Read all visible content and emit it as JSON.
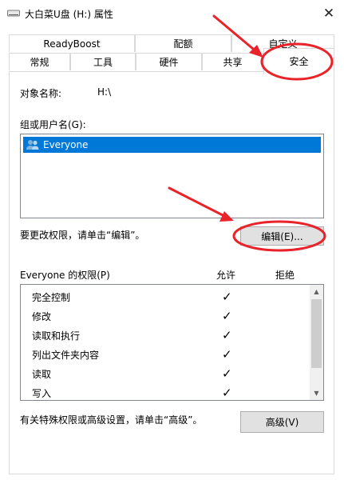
{
  "window": {
    "title": "大白菜U盘 (H:) 属性",
    "close_glyph": "✕"
  },
  "tabs": {
    "back_row": [
      "ReadyBoost",
      "配额",
      "自定义"
    ],
    "front_row": [
      "常规",
      "工具",
      "硬件",
      "共享"
    ],
    "active": "安全"
  },
  "security": {
    "object_name_label": "对象名称:",
    "object_name_value": "H:\\",
    "group_label": "组或用户名(G):",
    "users": [
      "Everyone"
    ],
    "edit_hint": "要更改权限，请单击“编辑”。",
    "edit_button": "编辑(E)...",
    "perm_title": "Everyone 的权限(P)",
    "allow_header": "允许",
    "deny_header": "拒绝",
    "permissions": [
      {
        "name": "完全控制",
        "allow": "✓"
      },
      {
        "name": "修改",
        "allow": "✓"
      },
      {
        "name": "读取和执行",
        "allow": "✓"
      },
      {
        "name": "列出文件夹内容",
        "allow": "✓"
      },
      {
        "name": "读取",
        "allow": "✓"
      },
      {
        "name": "写入",
        "allow": "✓"
      }
    ],
    "advanced_hint": "有关特殊权限或高级设置，请单击“高级”。",
    "advanced_button": "高级(V)"
  },
  "colors": {
    "selection": "#0078d7",
    "annotation": "#e8232a"
  }
}
